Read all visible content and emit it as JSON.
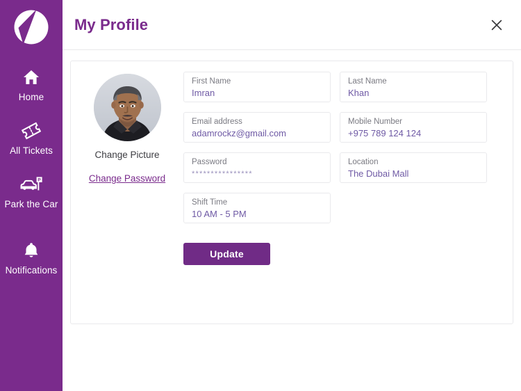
{
  "brand": {
    "logo_icon": "circle-v-logo-icon",
    "color": "#7a2b8c",
    "accent": "#702b86"
  },
  "sidebar": {
    "items": [
      {
        "label": "Home",
        "icon": "home-icon",
        "name": "home"
      },
      {
        "label": "All Tickets",
        "icon": "ticket-icon",
        "name": "all-tickets"
      },
      {
        "label": "Park the Car",
        "icon": "car-parking-icon",
        "name": "park-the-car"
      },
      {
        "label": "Notifications",
        "icon": "bell-icon",
        "name": "notifications"
      }
    ]
  },
  "header": {
    "title": "My Profile",
    "close_icon": "close-icon"
  },
  "profile": {
    "avatar_alt": "user-avatar",
    "change_picture_label": "Change Picture",
    "change_password_label": "Change Password"
  },
  "form": {
    "fields": [
      {
        "name": "first-name",
        "label": "First Name",
        "value": "Imran"
      },
      {
        "name": "last-name",
        "label": "Last Name",
        "value": "Khan"
      },
      {
        "name": "email-address",
        "label": "Email address",
        "value": "adamrockz@gmail.com"
      },
      {
        "name": "mobile-number",
        "label": "Mobile Number",
        "value": "+975 789 124 124"
      },
      {
        "name": "password",
        "label": "Password",
        "value": "****************",
        "masked": true
      },
      {
        "name": "location",
        "label": "Location",
        "value": "The Dubai Mall"
      },
      {
        "name": "shift-time",
        "label": "Shift Time",
        "value": "10 AM - 5 PM"
      }
    ],
    "submit_label": "Update"
  }
}
